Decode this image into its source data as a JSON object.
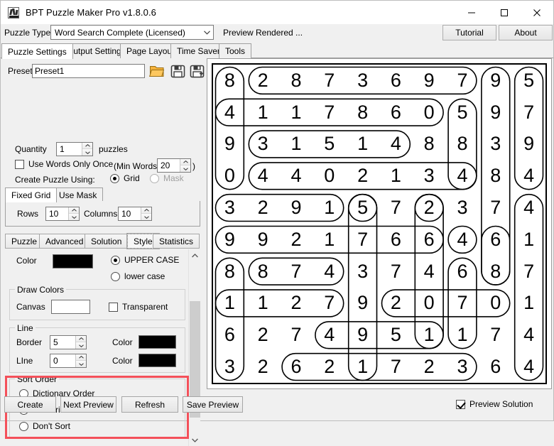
{
  "window": {
    "title": "BPT Puzzle Maker Pro v1.8.0.6",
    "icon": "app-icon",
    "minimize": "minimize-icon",
    "maximize": "maximize-icon",
    "close": "close-icon"
  },
  "toolbar": {
    "puzzle_type_label": "Puzzle Type",
    "puzzle_type_value": "Word Search Complete (Licensed)",
    "status": "Preview Rendered ...",
    "tutorial_label": "Tutorial",
    "about_label": "About"
  },
  "tabs": [
    {
      "label": "Puzzle Settings",
      "selected": true
    },
    {
      "label": "Output Settings",
      "selected": false
    },
    {
      "label": "Page Layout",
      "selected": false
    },
    {
      "label": "Time Saver",
      "selected": false
    },
    {
      "label": "Tools",
      "selected": false
    }
  ],
  "settings": {
    "preset_label": "Preset",
    "preset_value": "Preset1",
    "open_icon": "folder-open-icon",
    "save_icon": "save-icon",
    "save_as_icon": "save-as-icon",
    "quantity_label": "Quantity",
    "quantity_value": "1",
    "quantity_unit": "puzzles",
    "use_words_once_label": "Use Words Only Once",
    "use_words_once_checked": false,
    "min_words_prefix": "(Min Words:",
    "min_words_value": "20",
    "min_words_suffix": ")",
    "create_using_label": "Create Puzzle Using:",
    "create_using_grid": "Grid",
    "create_using_mask": "Mask",
    "create_using_selected": "Grid",
    "grid_tabs": [
      {
        "label": "Fixed Grid",
        "selected": true
      },
      {
        "label": "Use Mask",
        "selected": false
      }
    ],
    "rows_label": "Rows",
    "rows_value": "10",
    "columns_label": "Columns",
    "columns_value": "10",
    "style_tabs": [
      {
        "label": "Puzzle",
        "selected": false
      },
      {
        "label": "Advanced",
        "selected": false
      },
      {
        "label": "Solution",
        "selected": false
      },
      {
        "label": "Style",
        "selected": true
      },
      {
        "label": "Statistics",
        "selected": false
      }
    ],
    "color_label": "Color",
    "color_value": "#000000",
    "upper_case_label": "UPPER CASE",
    "lower_case_label": "lower case",
    "case_selected": "UPPER CASE",
    "draw_colors_label": "Draw Colors",
    "canvas_label": "Canvas",
    "canvas_color": "#ffffff",
    "transparent_label": "Transparent",
    "transparent_checked": false,
    "line_group_label": "Line",
    "border_label": "Border",
    "border_value": "5",
    "border_color_label": "Color",
    "border_color": "#000000",
    "line_label": "LIne",
    "line_value": "0",
    "line_color_label": "Color",
    "line_color": "#000000",
    "sort_order_label": "Sort Order",
    "sort_options": [
      {
        "label": "Dictionary Order",
        "selected": false
      },
      {
        "label": "Numeric Order",
        "selected": true
      },
      {
        "label": "Don't Sort",
        "selected": false
      }
    ],
    "highlight_color": "#f4505a",
    "scroll_up_icon": "chevron-up-icon",
    "scroll_down_icon": "chevron-down-icon"
  },
  "preview": {
    "rows": 10,
    "cols": 10,
    "grid": [
      [
        "8",
        "2",
        "8",
        "7",
        "3",
        "6",
        "9",
        "7",
        "9",
        "5"
      ],
      [
        "4",
        "1",
        "1",
        "7",
        "8",
        "6",
        "0",
        "5",
        "9",
        "7"
      ],
      [
        "9",
        "3",
        "1",
        "5",
        "1",
        "4",
        "8",
        "8",
        "3",
        "9"
      ],
      [
        "0",
        "4",
        "4",
        "0",
        "2",
        "1",
        "3",
        "4",
        "8",
        "4"
      ],
      [
        "3",
        "2",
        "9",
        "1",
        "5",
        "7",
        "2",
        "3",
        "7",
        "4"
      ],
      [
        "9",
        "9",
        "2",
        "1",
        "7",
        "6",
        "6",
        "4",
        "6",
        "1"
      ],
      [
        "8",
        "8",
        "7",
        "4",
        "3",
        "7",
        "4",
        "6",
        "8",
        "7"
      ],
      [
        "1",
        "1",
        "2",
        "7",
        "9",
        "2",
        "0",
        "7",
        "0",
        "1"
      ],
      [
        "6",
        "2",
        "7",
        "4",
        "9",
        "5",
        "1",
        "1",
        "7",
        "4"
      ],
      [
        "3",
        "2",
        "6",
        "2",
        "1",
        "7",
        "2",
        "3",
        "6",
        "4"
      ]
    ],
    "solutions": [
      {
        "r1": 0,
        "c1": 1,
        "r2": 0,
        "c2": 7,
        "word": "2873697"
      },
      {
        "r1": 0,
        "c1": 0,
        "r2": 3,
        "c2": 0,
        "word": "8490"
      },
      {
        "r1": 1,
        "c1": 0,
        "r2": 1,
        "c2": 6,
        "word": "4117860"
      },
      {
        "r1": 2,
        "c1": 1,
        "r2": 2,
        "c2": 5,
        "word": "31514"
      },
      {
        "r1": 3,
        "c1": 1,
        "r2": 3,
        "c2": 7,
        "word": "4402134"
      },
      {
        "r1": 4,
        "c1": 0,
        "r2": 4,
        "c2": 3,
        "word": "3291"
      },
      {
        "r1": 5,
        "c1": 0,
        "r2": 5,
        "c2": 6,
        "word": "9921766"
      },
      {
        "r1": 6,
        "c1": 1,
        "r2": 6,
        "c2": 3,
        "word": "874"
      },
      {
        "r1": 7,
        "c1": 0,
        "r2": 7,
        "c2": 3,
        "word": "1127"
      },
      {
        "r1": 7,
        "c1": 5,
        "r2": 7,
        "c2": 8,
        "word": "2070"
      },
      {
        "r1": 8,
        "c1": 3,
        "r2": 8,
        "c2": 6,
        "word": "4951"
      },
      {
        "r1": 9,
        "c1": 2,
        "r2": 9,
        "c2": 7,
        "word": "621723"
      },
      {
        "r1": 0,
        "c1": 8,
        "r2": 6,
        "c2": 8,
        "word": "9938768"
      },
      {
        "r1": 0,
        "c1": 9,
        "r2": 3,
        "c2": 9,
        "word": "5794"
      },
      {
        "r1": 4,
        "c1": 9,
        "r2": 9,
        "c2": 9,
        "word": "417144"
      },
      {
        "r1": 1,
        "c1": 7,
        "r2": 3,
        "c2": 7,
        "word": "584"
      },
      {
        "r1": 5,
        "c1": 7,
        "r2": 5,
        "c2": 7,
        "word": "4"
      },
      {
        "r1": 6,
        "c1": 0,
        "r2": 9,
        "c2": 0,
        "word": "8163"
      },
      {
        "r1": 4,
        "c1": 4,
        "r2": 9,
        "c2": 4,
        "word": "579391"
      },
      {
        "r1": 4,
        "c1": 6,
        "r2": 8,
        "c2": 6,
        "word": "26401"
      },
      {
        "r1": 6,
        "c1": 7,
        "r2": 8,
        "c2": 7,
        "word": "671"
      },
      {
        "r1": 5,
        "c1": 8,
        "r2": 6,
        "c2": 8,
        "word": "68"
      },
      {
        "r1": 4,
        "c1": 4,
        "r2": 4,
        "c2": 4,
        "word": "5"
      },
      {
        "r1": 4,
        "c1": 6,
        "r2": 4,
        "c2": 6,
        "word": "2"
      }
    ]
  },
  "bottom": {
    "create_label": "Create",
    "next_preview_label": "Next Preview",
    "refresh_label": "Refresh",
    "save_preview_label": "Save Preview",
    "preview_solution_label": "Preview Solution",
    "preview_solution_checked": true
  }
}
